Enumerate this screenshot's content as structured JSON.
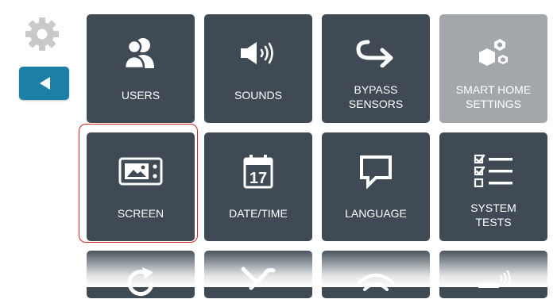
{
  "colors": {
    "tile": "#3f4a55",
    "tile_disabled": "#a3a7ab",
    "back_button": "#1d7fa8",
    "selection_outline": "#d8232a",
    "gear": "#c9c9c9"
  },
  "sidebar": {
    "settings_icon": "gear-icon",
    "back_icon": "triangle-left-icon"
  },
  "tiles": [
    {
      "label": "USERS",
      "icon": "users-icon"
    },
    {
      "label": "SOUNDS",
      "icon": "speaker-icon"
    },
    {
      "label": "BYPASS\nSENSORS",
      "icon": "bypass-arrow-icon"
    },
    {
      "label": "SMART HOME\nSETTINGS",
      "icon": "smart-home-icon",
      "disabled": true
    },
    {
      "label": "SCREEN",
      "icon": "screen-icon",
      "selected": true
    },
    {
      "label": "DATE/TIME",
      "icon": "calendar-icon",
      "day": "17"
    },
    {
      "label": "LANGUAGE",
      "icon": "speech-bubble-icon"
    },
    {
      "label": "SYSTEM\nTESTS",
      "icon": "checklist-icon"
    }
  ],
  "partial_tiles": [
    {
      "icon": "refresh-icon"
    },
    {
      "icon": "tools-icon"
    },
    {
      "icon": "wifi-icon"
    },
    {
      "icon": "signal-icon"
    }
  ]
}
